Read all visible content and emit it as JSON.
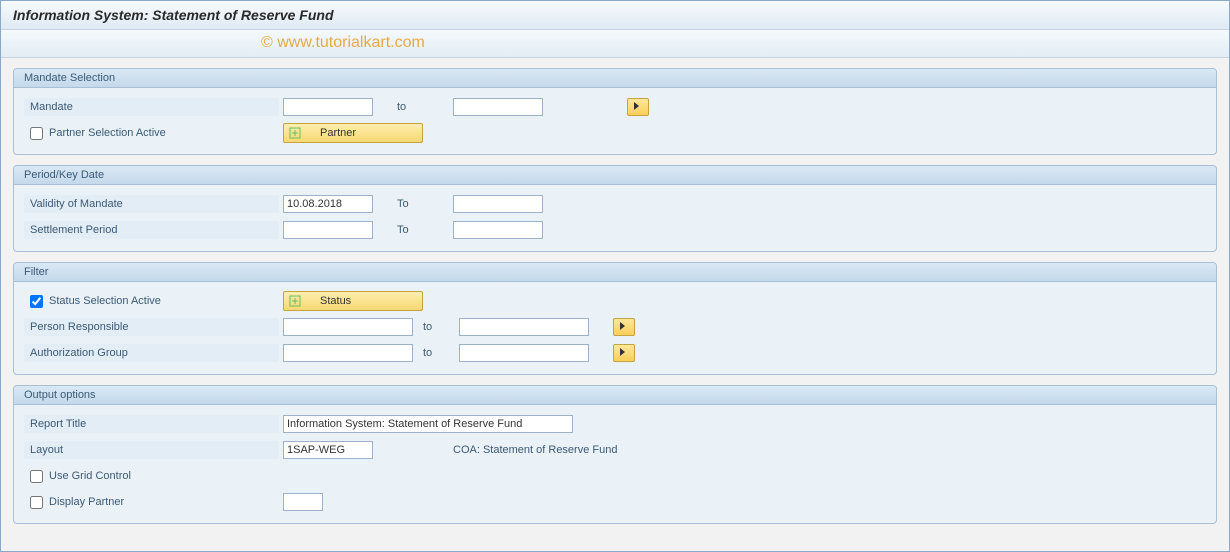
{
  "title": "Information System: Statement of Reserve Fund",
  "watermark": "© www.tutorialkart.com",
  "groups": {
    "mandate_selection": {
      "header": "Mandate Selection",
      "mandate_label": "Mandate",
      "mandate_from": "",
      "to_label": "to",
      "mandate_to": "",
      "partner_checkbox_label": "Partner Selection Active",
      "partner_checked": false,
      "partner_button": "Partner"
    },
    "period": {
      "header": "Period/Key Date",
      "validity_label": "Validity of Mandate",
      "validity_from": "10.08.2018",
      "to_label": "To",
      "validity_to": "",
      "settlement_label": "Settlement Period",
      "settlement_from": "",
      "settlement_to": ""
    },
    "filter": {
      "header": "Filter",
      "status_checkbox_label": "Status Selection Active",
      "status_checked": true,
      "status_button": "Status",
      "person_label": "Person Responsible",
      "person_from": "",
      "to_label": "to",
      "person_to": "",
      "auth_label": "Authorization Group",
      "auth_from": "",
      "auth_to": ""
    },
    "output": {
      "header": "Output options",
      "report_title_label": "Report Title",
      "report_title_value": "Information System: Statement of Reserve Fund",
      "layout_label": "Layout",
      "layout_value": "1SAP-WEG",
      "layout_desc": "COA: Statement of Reserve Fund",
      "grid_checkbox_label": "Use Grid Control",
      "grid_checked": false,
      "display_partner_label": "Display Partner",
      "display_partner_checked": false,
      "display_partner_value": ""
    }
  }
}
